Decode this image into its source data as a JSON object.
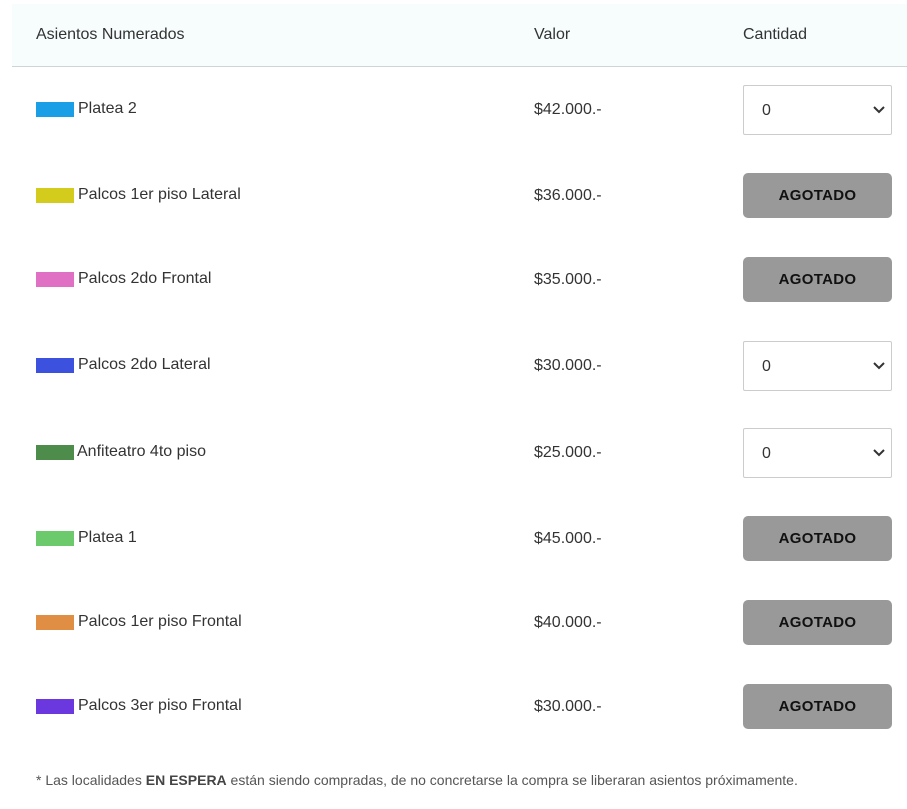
{
  "header": {
    "col_name": "Asientos Numerados",
    "col_value": "Valor",
    "col_qty": "Cantidad"
  },
  "rows": [
    {
      "name": "Platea 2",
      "color": "#1a9ee6",
      "price": "$42.000.-",
      "status": "select",
      "qty": "0"
    },
    {
      "name": "Palcos 1er piso Lateral",
      "color": "#d4cc1c",
      "price": "$36.000.-",
      "status": "sold_out",
      "sold_label": "AGOTADO"
    },
    {
      "name": "Palcos 2do Frontal",
      "color": "#e070c4",
      "price": "$35.000.-",
      "status": "sold_out",
      "sold_label": "AGOTADO"
    },
    {
      "name": "Palcos 2do Lateral",
      "color": "#3c52de",
      "price": "$30.000.-",
      "status": "select",
      "qty": "0"
    },
    {
      "name": "Anfiteatro 4to piso",
      "color": "#4e8c4c",
      "price": "$25.000.-",
      "status": "select",
      "qty": "0"
    },
    {
      "name": "Platea 1",
      "color": "#6cc96c",
      "price": "$45.000.-",
      "status": "sold_out",
      "sold_label": "AGOTADO"
    },
    {
      "name": "Palcos 1er piso Frontal",
      "color": "#e08e44",
      "price": "$40.000.-",
      "status": "sold_out",
      "sold_label": "AGOTADO"
    },
    {
      "name": "Palcos 3er piso Frontal",
      "color": "#6a38de",
      "price": "$30.000.-",
      "status": "sold_out",
      "sold_label": "AGOTADO"
    }
  ],
  "footnote": {
    "prefix": "* Las localidades ",
    "bold": "EN ESPERA",
    "suffix": " están siendo compradas, de no concretarse la compra se liberaran asientos próximamente."
  }
}
